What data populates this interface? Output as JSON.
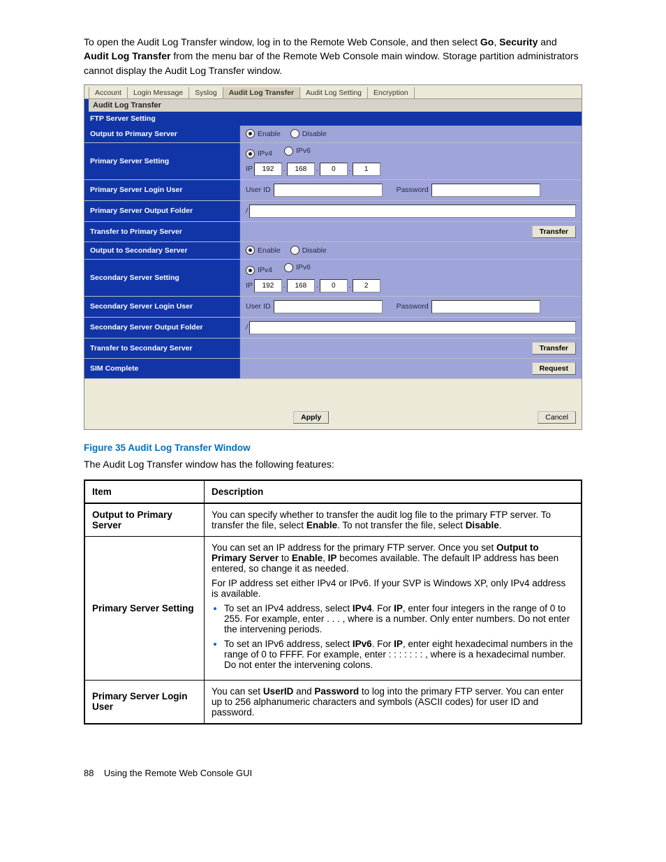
{
  "intro": {
    "p1a": "To open the Audit Log Transfer window, log in to the Remote Web Console, and then select ",
    "g": "Go",
    "p1b": ", ",
    "s": "Security",
    "p1c": " and ",
    "a": "Audit Log Transfer",
    "p1d": " from the menu bar of the Remote Web Console main window. Storage partition administrators cannot display the Audit Log Transfer window."
  },
  "screenshot": {
    "tabs": [
      "Account",
      "Login Message",
      "Syslog",
      "Audit Log Transfer",
      "Audit Log Setting",
      "Encryption"
    ],
    "active_tab": 3,
    "panel_title": "Audit Log Transfer",
    "section1": "FTP Server Setting",
    "rows": {
      "out_primary": "Output to Primary Server",
      "primary_setting": "Primary Server Setting",
      "primary_login": "Primary Server Login User",
      "primary_folder": "Primary Server Output Folder",
      "transfer_primary": "Transfer to Primary Server",
      "out_secondary": "Output to Secondary Server",
      "secondary_setting": "Secondary Server Setting",
      "secondary_login": "Secondary Server Login User",
      "secondary_folder": "Secondary Server Output Folder",
      "transfer_secondary": "Transfer to Secondary Server",
      "sim": "SIM Complete"
    },
    "labels": {
      "enable": "Enable",
      "disable": "Disable",
      "ipv4": "IPv4",
      "ipv6": "IPv6",
      "ip": "IP",
      "userid": "User ID",
      "password": "Password",
      "slash": "/"
    },
    "ip1": [
      "192",
      "168",
      "0",
      "1"
    ],
    "ip2": [
      "192",
      "168",
      "0",
      "2"
    ],
    "buttons": {
      "transfer": "Transfer",
      "request": "Request",
      "apply": "Apply",
      "cancel": "Cancel"
    }
  },
  "figcaption": "Figure 35 Audit Log Transfer Window",
  "afterfig": "The Audit Log Transfer window has the following features:",
  "table": {
    "h1": "Item",
    "h2": "Description",
    "r1_item": "Output to Primary Server",
    "r1_desc_a": "You can specify whether to transfer the audit log file to the primary FTP server. To transfer the file, select ",
    "r1_b1": "Enable",
    "r1_desc_b": ". To not transfer the file, select ",
    "r1_b2": "Disable",
    "r1_desc_c": ".",
    "r2_item": "Primary Server Setting",
    "r2_p1a": "You can set an IP address for the primary FTP server. Once you set ",
    "r2_b1": "Output to Primary Server",
    "r2_p1b": " to ",
    "r2_b2": "Enable",
    "r2_p1c": ", ",
    "r2_b3": "IP",
    "r2_p1d": " becomes available. The default IP address has been entered, so change it as needed.",
    "r2_p2": "For IP address set either IPv4 or IPv6. If your SVP is Windows XP, only IPv4 address is available.",
    "r2_li1a": "To set an IPv4 address, select ",
    "r2_li1b1": "IPv4",
    "r2_li1b": ". For ",
    "r2_li1b2": "IP",
    "r2_li1c": ", enter four integers in the range of 0 to 255. For example, enter      .      .      .      , where    is a number. Only enter numbers. Do not enter the intervening periods.",
    "r2_li2a": "To set an IPv6 address, select ",
    "r2_li2b1": "IPv6",
    "r2_li2b": ". For ",
    "r2_li2b2": "IP",
    "r2_li2c": ", enter eight hexadecimal numbers in the range of 0 to FFFF. For example, enter        :        :        :        :        :        :        :        , where    is a hexadecimal number. Do not enter the intervening colons.",
    "r3_item": "Primary Server Login User",
    "r3_a": "You can set ",
    "r3_b1": "UserID",
    "r3_b": " and ",
    "r3_b2": "Password",
    "r3_c": " to log into the primary FTP server. You can enter up to 256 alphanumeric characters and symbols (ASCII codes) for user ID and password."
  },
  "footer": {
    "page": "88",
    "title": "Using the Remote Web Console GUI"
  }
}
